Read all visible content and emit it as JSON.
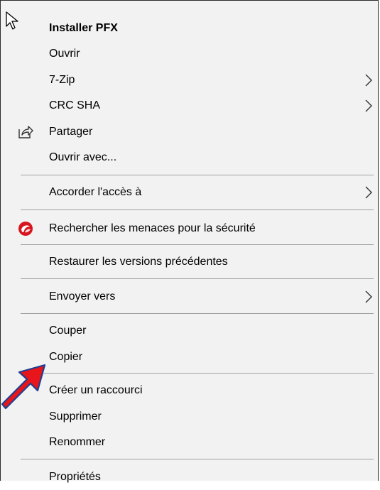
{
  "menu": {
    "items": [
      {
        "label": "Installer PFX",
        "bold": true,
        "submenu": false
      },
      {
        "label": "Ouvrir",
        "submenu": false
      },
      {
        "label": "7-Zip",
        "submenu": true
      },
      {
        "label": "CRC SHA",
        "submenu": true
      },
      {
        "label": "Partager",
        "submenu": false,
        "icon": "share-icon"
      },
      {
        "label": "Ouvrir avec...",
        "submenu": false
      },
      {
        "label": "Accorder l'accès à",
        "submenu": true
      },
      {
        "label": "Rechercher les menaces pour la sécurité",
        "submenu": false,
        "icon": "security-scan-icon"
      },
      {
        "label": "Restaurer les versions précédentes",
        "submenu": false
      },
      {
        "label": "Envoyer vers",
        "submenu": true
      },
      {
        "label": "Couper",
        "submenu": false
      },
      {
        "label": "Copier",
        "submenu": false
      },
      {
        "label": "Créer un raccourci",
        "submenu": false
      },
      {
        "label": "Supprimer",
        "submenu": false
      },
      {
        "label": "Renommer",
        "submenu": false
      },
      {
        "label": "Propriétés",
        "submenu": false
      }
    ]
  },
  "colors": {
    "menu_bg": "#f2f2f2",
    "separator": "#a0a0a0",
    "arrow_red": "#e8151b",
    "arrow_outline": "#1f3f8f",
    "security_icon_red": "#d8151f"
  }
}
